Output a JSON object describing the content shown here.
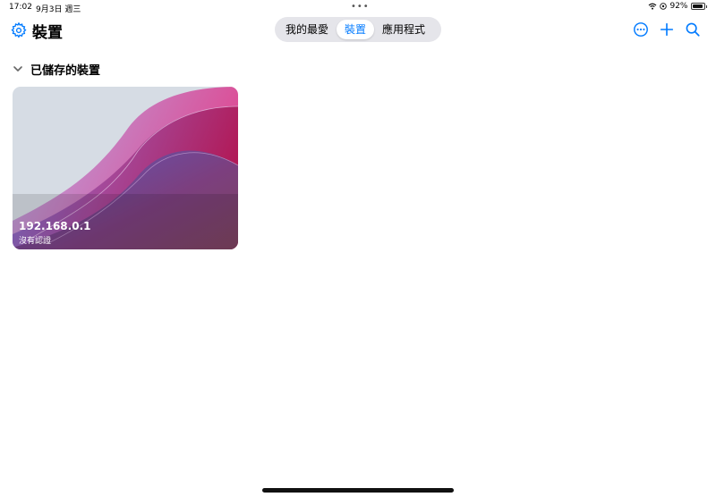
{
  "status_bar": {
    "time": "17:02",
    "date": "9月3日 週三",
    "battery": "92%",
    "battery_level": 0.92,
    "icons": [
      "wifi-icon",
      "location-icon",
      "battery-icon"
    ]
  },
  "header": {
    "title": "裝置",
    "settings_icon": "gear-icon",
    "tabs": [
      {
        "label": "我的最愛",
        "active": false
      },
      {
        "label": "裝置",
        "active": true
      },
      {
        "label": "應用程式",
        "active": false
      }
    ],
    "actions": [
      "more-icon",
      "plus-icon",
      "search-icon"
    ]
  },
  "section": {
    "title": "已儲存的裝置",
    "chevron": "chevron-down-icon"
  },
  "devices": [
    {
      "ip": "192.168.0.1",
      "auth": "沒有認證"
    }
  ],
  "colors": {
    "accent": "#007aff",
    "segment_bg": "#e5e5ea",
    "card_bg": "#d7dde5"
  }
}
